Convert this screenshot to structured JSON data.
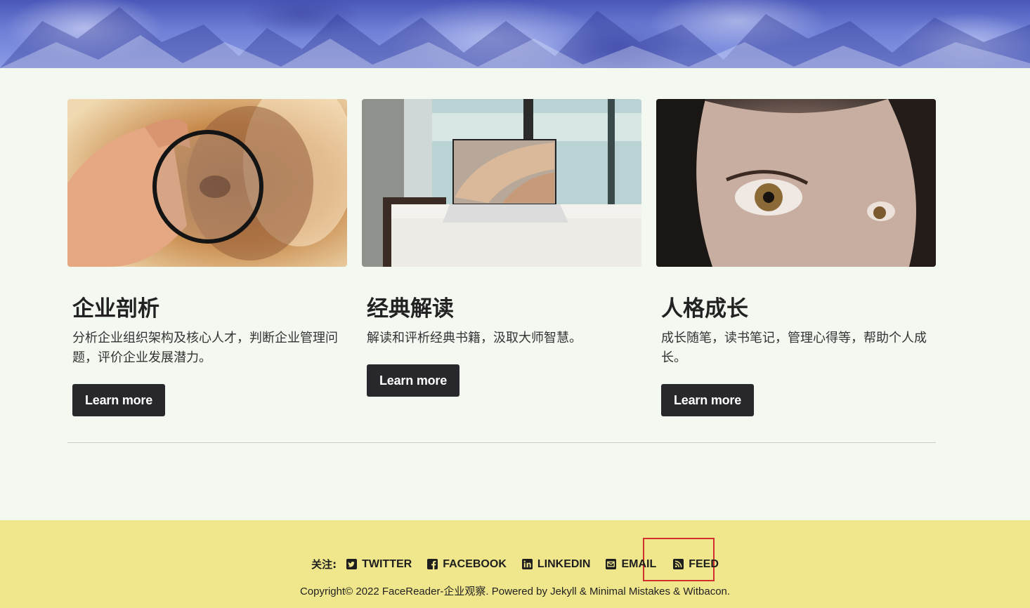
{
  "cards": [
    {
      "title": "企业剖析",
      "excerpt": "分析企业组织架构及核心人才，判断企业管理问题，评价企业发展潜力。",
      "button": "Learn more",
      "image_desc": "magnifier-lens-image"
    },
    {
      "title": "经典解读",
      "excerpt": "解读和评析经典书籍，汲取大师智慧。",
      "button": "Learn more",
      "image_desc": "laptop-image"
    },
    {
      "title": "人格成长",
      "excerpt": "成长随笔，读书笔记，管理心得等，帮助个人成长。",
      "button": "Learn more",
      "image_desc": "eye-portrait-image"
    }
  ],
  "footer": {
    "follow_label": "关注:",
    "links": [
      {
        "label": "TWITTER",
        "icon": "twitter-icon"
      },
      {
        "label": "FACEBOOK",
        "icon": "facebook-icon"
      },
      {
        "label": "LINKEDIN",
        "icon": "linkedin-icon"
      },
      {
        "label": "EMAIL",
        "icon": "email-icon"
      },
      {
        "label": "FEED",
        "icon": "rss-icon"
      }
    ],
    "copyright": "Copyright© 2022 FaceReader-企业观察. Powered by Jekyll & Minimal Mistakes & Witbacon."
  },
  "colors": {
    "footer_bg": "#f0e68c",
    "page_bg": "#f3f8f1",
    "button_bg": "#28282c",
    "highlight": "#d32f2f"
  }
}
